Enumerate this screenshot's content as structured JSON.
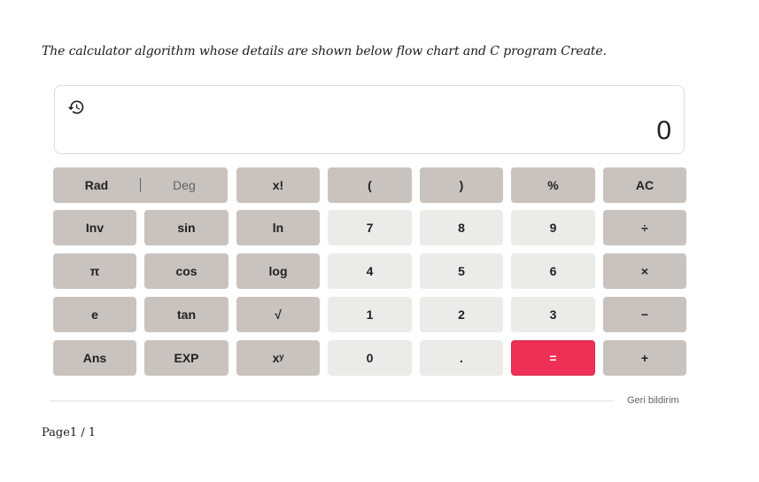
{
  "heading": "The calculator algorithm whose details are shown below flow chart and C program Create.",
  "display": {
    "value": "0",
    "history_icon": "history-icon"
  },
  "keys": {
    "rad": "Rad",
    "deg": "Deg",
    "factorial": "x!",
    "open_paren": "(",
    "close_paren": ")",
    "percent": "%",
    "clear": "AC",
    "inv": "Inv",
    "sin": "sin",
    "ln": "ln",
    "seven": "7",
    "eight": "8",
    "nine": "9",
    "divide": "÷",
    "pi": "π",
    "cos": "cos",
    "log": "log",
    "four": "4",
    "five": "5",
    "six": "6",
    "multiply": "×",
    "e": "e",
    "tan": "tan",
    "sqrt": "√",
    "one": "1",
    "two": "2",
    "three": "3",
    "minus": "−",
    "ans": "Ans",
    "exp": "EXP",
    "power": "xʸ",
    "zero": "0",
    "dot": ".",
    "equals": "=",
    "plus": "+"
  },
  "colors": {
    "function_key": "#c9c3bf",
    "number_key": "#ebebea",
    "equals_key": "#ee2f56"
  },
  "footer": {
    "feedback": "Geri bildirim"
  },
  "page_indicator": "Page1 / 1"
}
